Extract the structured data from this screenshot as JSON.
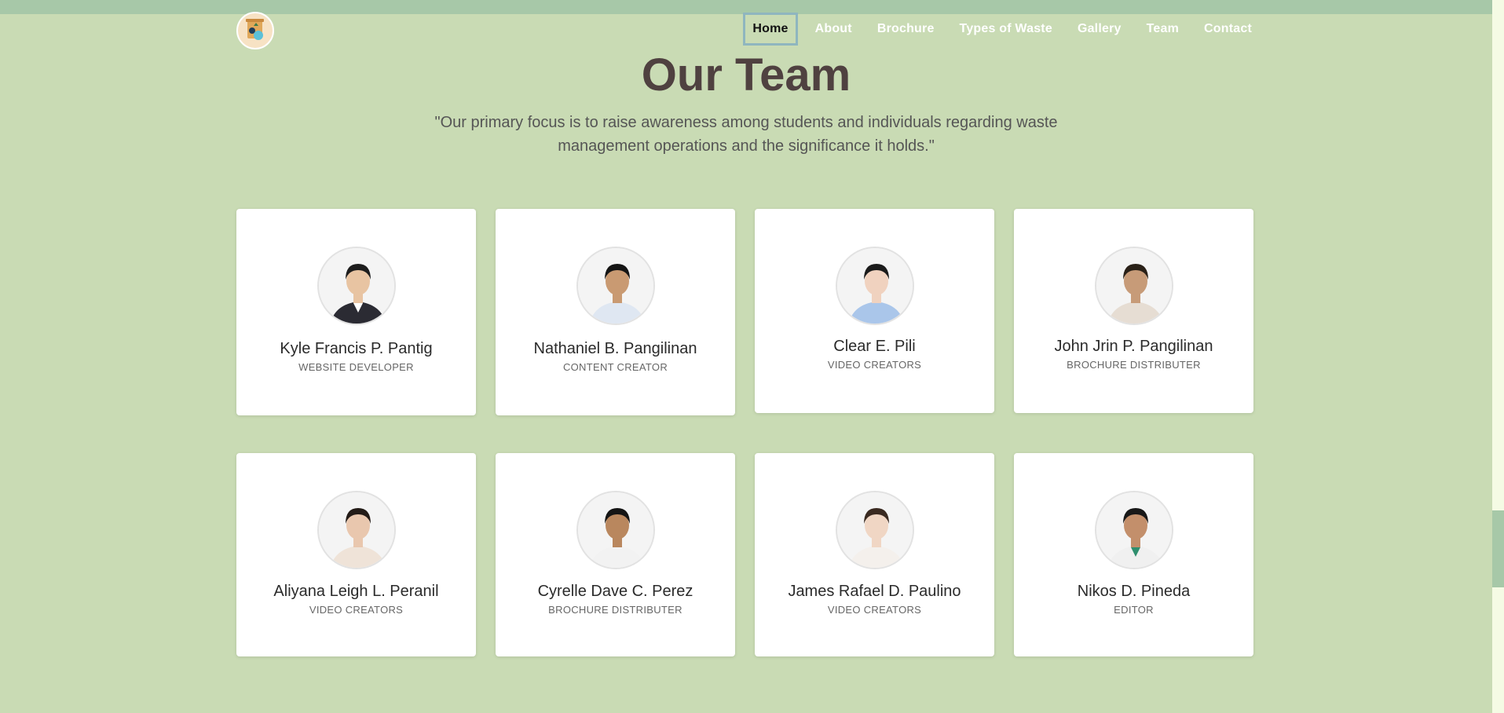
{
  "nav": {
    "items": [
      {
        "label": "Home",
        "active": true
      },
      {
        "label": "About"
      },
      {
        "label": "Brochure"
      },
      {
        "label": "Types of Waste"
      },
      {
        "label": "Gallery"
      },
      {
        "label": "Team"
      },
      {
        "label": "Contact"
      }
    ]
  },
  "page": {
    "title": "Our Team",
    "subtitle": "\"Our primary focus is to raise awareness among students and individuals regarding waste management operations and the significance it holds.\""
  },
  "team": [
    {
      "name": "Kyle Francis P. Pantig",
      "role": "WEBSITE DEVELOPER",
      "skin": "#e8c4a2",
      "hair": "#1d1d1d",
      "shirt": "#2b2b33",
      "accent": "#ffffff"
    },
    {
      "name": "Nathaniel B. Pangilinan",
      "role": "CONTENT CREATOR",
      "skin": "#c99a72",
      "hair": "#151515",
      "shirt": "#dfe7f2",
      "accent": "#dfe7f2"
    },
    {
      "name": "Clear E. Pili",
      "role": "VIDEO CREATORS",
      "skin": "#f0d2bf",
      "hair": "#1b1b1b",
      "shirt": "#aac6ea",
      "accent": "#aac6ea"
    },
    {
      "name": "John Jrin P. Pangilinan",
      "role": "BROCHURE DISTRIBUTER",
      "skin": "#c79b78",
      "hair": "#2a2118",
      "shirt": "#e6ddd3",
      "accent": "#e6ddd3"
    },
    {
      "name": "Aliyana Leigh L. Peranil",
      "role": "VIDEO CREATORS",
      "skin": "#e9c7ae",
      "hair": "#231b17",
      "shirt": "#efe3d8",
      "accent": "#efe3d8"
    },
    {
      "name": "Cyrelle Dave C. Perez",
      "role": "BROCHURE DISTRIBUTER",
      "skin": "#b9875e",
      "hair": "#151515",
      "shirt": "#f2f2f2",
      "accent": "#f2f2f2"
    },
    {
      "name": "James Rafael D. Paulino",
      "role": "VIDEO CREATORS",
      "skin": "#f0d6c4",
      "hair": "#3a2a21",
      "shirt": "#f4f0ec",
      "accent": "#f4f0ec"
    },
    {
      "name": "Nikos D. Pineda",
      "role": "EDITOR",
      "skin": "#c38f6b",
      "hair": "#181818",
      "shirt": "#f0f0f0",
      "accent": "#2f8f6e"
    }
  ],
  "colors": {
    "background": "#c9dbb4",
    "top_strip": "#a7c8a8",
    "title": "#4f4140",
    "nav_text": "#ffffff",
    "nav_active_border": "#8fb6bf"
  }
}
